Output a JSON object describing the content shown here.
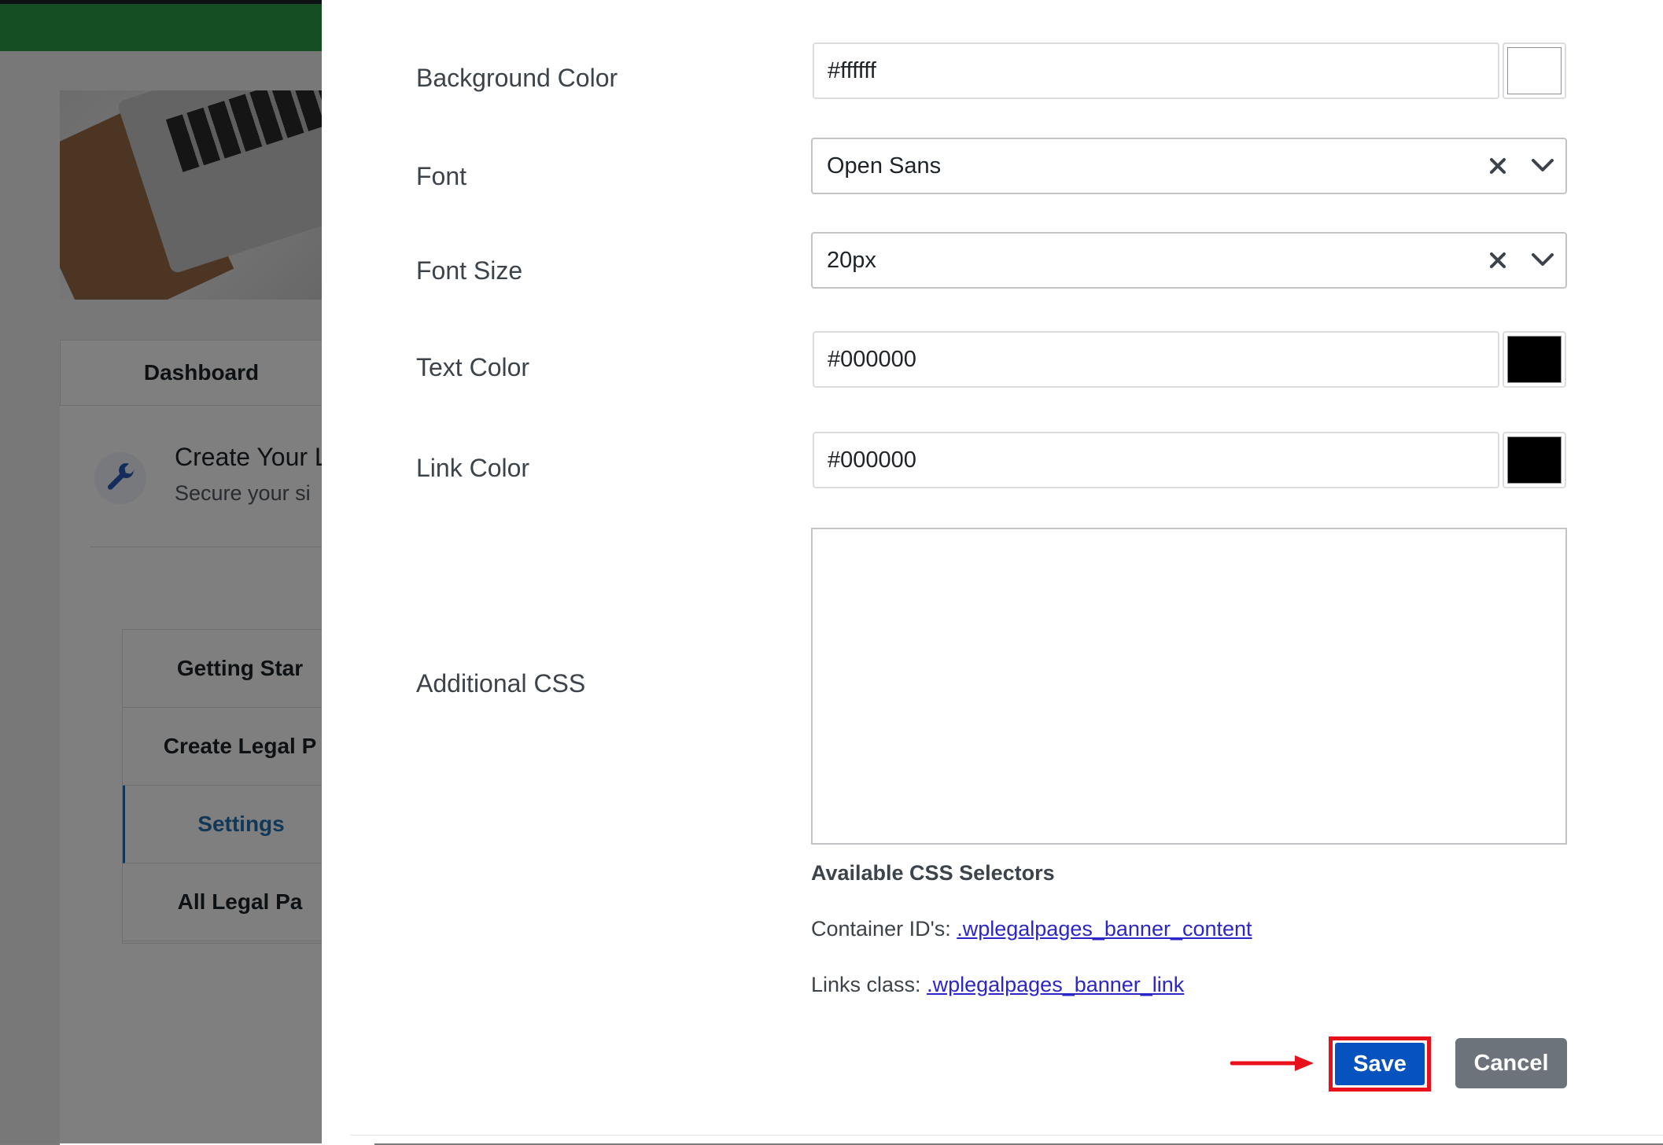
{
  "background_page": {
    "tab_dashboard": "Dashboard",
    "card_title": "Create Your L",
    "card_subtitle": "Secure your si",
    "menu": [
      "Getting Star",
      "Create Legal P",
      "Settings",
      "All Legal Pa"
    ],
    "active_menu_index": 2
  },
  "form": {
    "background_color": {
      "label": "Background Color",
      "value": "#ffffff",
      "swatch": "#ffffff"
    },
    "font": {
      "label": "Font",
      "value": "Open Sans"
    },
    "font_size": {
      "label": "Font Size",
      "value": "20px"
    },
    "text_color": {
      "label": "Text Color",
      "value": "#000000",
      "swatch": "#000000"
    },
    "link_color": {
      "label": "Link Color",
      "value": "#000000",
      "swatch": "#000000"
    },
    "additional_css": {
      "label": "Additional CSS",
      "value": ""
    }
  },
  "css_selectors": {
    "heading": "Available CSS Selectors",
    "container_label": "Container ID's: ",
    "container_value": ".wplegalpages_banner_content",
    "links_label": "Links class: ",
    "links_value": ".wplegalpages_banner_link"
  },
  "actions": {
    "save": "Save",
    "cancel": "Cancel"
  },
  "colors": {
    "primary": "#0653c0",
    "secondary": "#6c737a",
    "highlight": "#e8101a",
    "header_green": "#2a9c45",
    "link": "#2c26c7"
  },
  "icons": {
    "select_clear": "close-icon",
    "select_toggle": "chevron-down-icon",
    "card_icon": "wrench-icon",
    "annotation": "arrow-right-icon"
  }
}
